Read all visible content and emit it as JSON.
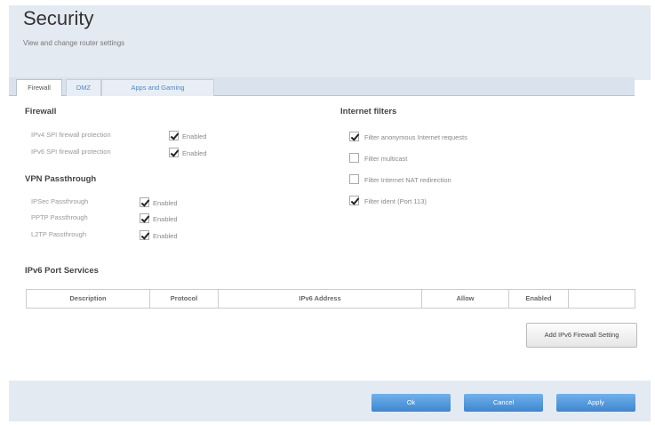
{
  "header": {
    "title": "Security",
    "subtitle": "View and change router settings"
  },
  "tabs": [
    {
      "label": "Firewall",
      "active": true
    },
    {
      "label": "DMZ",
      "active": false
    },
    {
      "label": "Apps and Gaming",
      "active": false
    }
  ],
  "firewall": {
    "title": "Firewall",
    "rows": [
      {
        "label": "IPv4 SPI firewall protection",
        "checkbox_label": "Enabled",
        "checked": true
      },
      {
        "label": "IPv6 SPI firewall protection",
        "checkbox_label": "Enabled",
        "checked": true
      }
    ]
  },
  "vpn": {
    "title": "VPN Passthrough",
    "rows": [
      {
        "label": "IPSec Passthrough",
        "checkbox_label": "Enabled",
        "checked": true
      },
      {
        "label": "PPTP Passthrough",
        "checkbox_label": "Enabled",
        "checked": true
      },
      {
        "label": "L2TP Passthrough",
        "checkbox_label": "Enabled",
        "checked": true
      }
    ]
  },
  "internet_filters": {
    "title": "Internet filters",
    "items": [
      {
        "label": "Filter anonymous Internet requests",
        "checked": true
      },
      {
        "label": "Filter multicast",
        "checked": false
      },
      {
        "label": "Filter Internet NAT redirection",
        "checked": false
      },
      {
        "label": "Filter ident (Port 113)",
        "checked": true
      }
    ]
  },
  "ipv6": {
    "title": "IPv6 Port Services",
    "columns": [
      "Description",
      "Protocol",
      "IPv6 Address",
      "Allow",
      "Enabled",
      ""
    ],
    "add_button": "Add IPv6 Firewall Setting"
  },
  "footer": {
    "ok": "Ok",
    "cancel": "Cancel",
    "apply": "Apply"
  },
  "colors": {
    "accent": "#4a90d9",
    "header_bg": "#e4eaf2"
  }
}
